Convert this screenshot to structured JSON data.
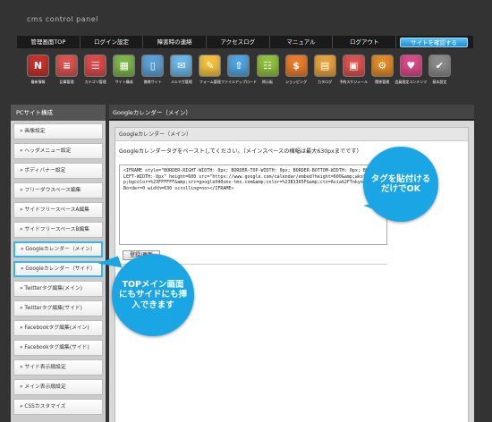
{
  "app": {
    "title": "cms control panel"
  },
  "topnav": {
    "items": [
      "管理画面TOP",
      "ログイン設定",
      "障害時の連絡",
      "アクセスログ",
      "マニュアル",
      "ログアウト"
    ],
    "cta": "サイトを確認する"
  },
  "iconbar": [
    {
      "label": "最新情報",
      "icon": "news-icon",
      "color": "#c9302c",
      "glyph": "N"
    },
    {
      "label": "記事管理",
      "icon": "article-icon",
      "color": "#d9534f",
      "glyph": "≡"
    },
    {
      "label": "カテゴリ管理",
      "icon": "category-list-icon",
      "color": "#e04848",
      "glyph": "☰"
    },
    {
      "label": "サイト構成",
      "icon": "layout-icon",
      "color": "#7ab648",
      "glyph": "▦"
    },
    {
      "label": "携帯サイト",
      "icon": "mobile-icon",
      "color": "#5aa0d8",
      "glyph": "▯"
    },
    {
      "label": "メルマガ管理",
      "icon": "mail-magazine-icon",
      "color": "#6bb5e8",
      "glyph": "✉"
    },
    {
      "label": "フォーム管理",
      "icon": "form-icon",
      "color": "#f0c040",
      "glyph": "✎"
    },
    {
      "label": "ファイルアップロード",
      "icon": "file-upload-icon",
      "color": "#4ea3e0",
      "glyph": "⇧"
    },
    {
      "label": "掲示板",
      "icon": "bbs-icon",
      "color": "#8fbf3f",
      "glyph": "☷"
    },
    {
      "label": "ショッピング",
      "icon": "shopping-icon",
      "color": "#e87b2c",
      "glyph": "$"
    },
    {
      "label": "カタログ",
      "icon": "catalog-icon",
      "color": "#e6a23c",
      "glyph": "▤"
    },
    {
      "label": "予約スケジュール",
      "icon": "schedule-icon",
      "color": "#d9534f",
      "glyph": "▣"
    },
    {
      "label": "関係管理",
      "icon": "relation-icon",
      "color": "#e08a2a",
      "glyph": "⚙"
    },
    {
      "label": "会員限定コンテンツ",
      "icon": "members-icon",
      "color": "#d94a88",
      "glyph": "♥"
    },
    {
      "label": "基本設定",
      "icon": "settings-icon",
      "color": "#8a8a8a",
      "glyph": "✔"
    }
  ],
  "sidebar": {
    "title": "PCサイト構成",
    "items": [
      "画像設定",
      "ヘッダメニュー設定",
      "ボディバナー設定",
      "フリーダウスペース編集",
      "サイドフリースペースA編集",
      "サイドフリースペースB編集",
      "Googleカレンダー（メイン）",
      "Googleカレンダー（サイド）",
      "Twitterタグ編集(メイン)",
      "Twitterタグ編集(サイド)",
      "Facebookタグ編集(メイン)",
      "Facebookタグ編集(サイド)",
      "サイド表示順設定",
      "メイン表示順設定",
      "CSSカスタマイズ"
    ]
  },
  "main": {
    "header": "Googleカレンダー（メイン）",
    "panel_title": "Googleカレンダー（メイン）",
    "description": "Googleカレンダータグをペーストしてください。（メインスペースの横幅は最大630pxまでです）",
    "code": "<IFRAME style=\"BORDER-RIGHT-WIDTH: 0px; BORDER-TOP-WIDTH: 0px; BORDER-BOTTOM-WIDTH: 0px; BORDER-LEFT-WIDTH: 0px\" height=600 src=\"https://www.google.com/calendar/embed?height=600&amp;wkst=1&amp;bgcolor=%23FFFFFF&amp;src=googleX40cms-tmx.com&amp;color=%23B1365F&amp;ctz=Asia%2FTokyo\" frameBorder=0 width=630 scrolling=no></IFRAME>",
    "save_button": "登録/更新"
  },
  "callouts": {
    "right": "タグを貼付けるだけでOK",
    "left": "TOPメイン画面にもサイドにも挿入できます"
  }
}
